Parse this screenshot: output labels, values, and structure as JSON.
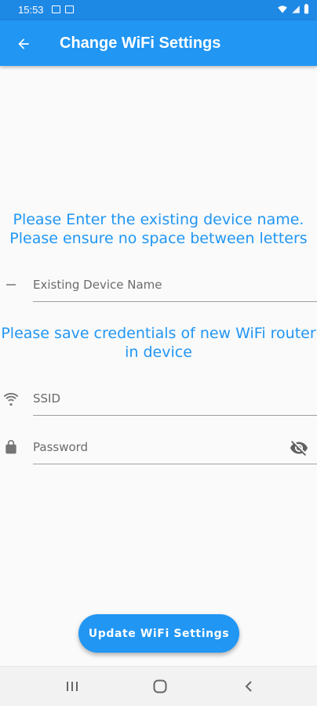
{
  "status_bar": {
    "time": "15:53"
  },
  "app_bar": {
    "title": "Change WiFi Settings"
  },
  "section_device": {
    "instruction": "Please Enter the existing device name.\nPlease ensure no space between letters",
    "device_name_placeholder": "Existing Device Name"
  },
  "section_wifi": {
    "instruction": "Please save credentials of new WiFi router\nin device",
    "ssid_placeholder": "SSID",
    "password_placeholder": "Password"
  },
  "actions": {
    "update_button_label": "Update WiFi Settings"
  },
  "colors": {
    "primary": "#2196F3",
    "status_bar": "#1E88E5",
    "background": "#FAFAFA"
  },
  "icons": {
    "back": "arrow-back-icon",
    "device": "minus-icon",
    "ssid": "wifi-icon",
    "password": "lock-icon",
    "toggle_visibility": "visibility-off-icon",
    "nav_recents": "recents-icon",
    "nav_home": "home-icon",
    "nav_back": "chevron-left-icon"
  }
}
